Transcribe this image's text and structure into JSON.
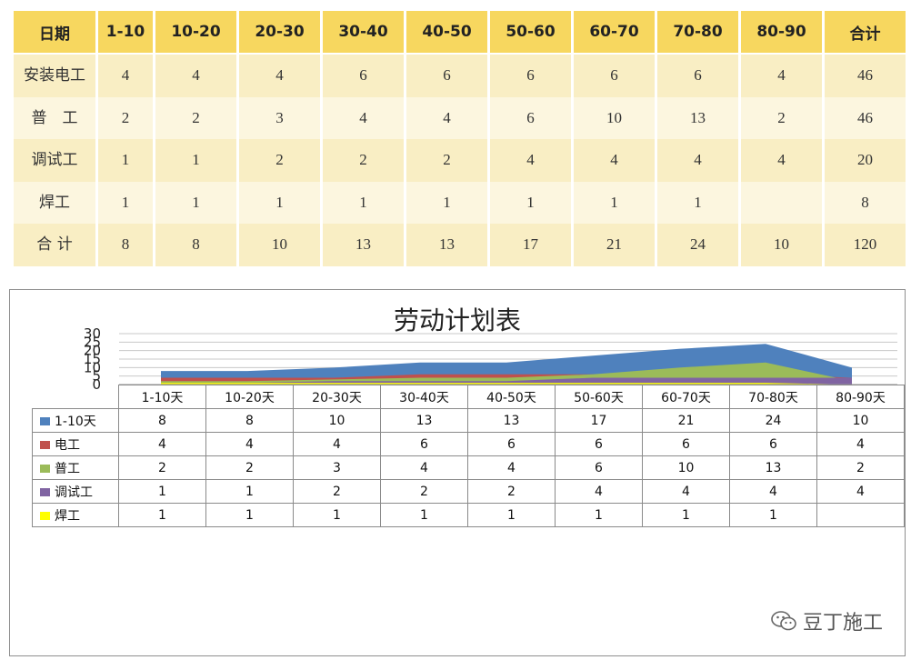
{
  "top_table": {
    "headers": [
      "日期",
      "1-10",
      "10-20",
      "20-30",
      "30-40",
      "40-50",
      "50-60",
      "60-70",
      "70-80",
      "80-90",
      "合计"
    ],
    "rows": [
      {
        "label": "安装电工",
        "values": [
          "4",
          "4",
          "4",
          "6",
          "6",
          "6",
          "6",
          "6",
          "4",
          "46"
        ]
      },
      {
        "label": "普　工",
        "values": [
          "2",
          "2",
          "3",
          "4",
          "4",
          "6",
          "10",
          "13",
          "2",
          "46"
        ]
      },
      {
        "label": "调试工",
        "values": [
          "1",
          "1",
          "2",
          "2",
          "2",
          "4",
          "4",
          "4",
          "4",
          "20"
        ]
      },
      {
        "label": "焊工",
        "values": [
          "1",
          "1",
          "1",
          "1",
          "1",
          "1",
          "1",
          "1",
          "",
          "8"
        ]
      },
      {
        "label": "合 计",
        "values": [
          "8",
          "8",
          "10",
          "13",
          "13",
          "17",
          "21",
          "24",
          "10",
          "120"
        ]
      }
    ]
  },
  "chart_data": {
    "type": "area",
    "title": "劳动计划表",
    "categories": [
      "1-10天",
      "10-20天",
      "20-30天",
      "30-40天",
      "40-50天",
      "50-60天",
      "60-70天",
      "70-80天",
      "80-90天"
    ],
    "ylim": [
      0,
      30
    ],
    "yticks": [
      "30",
      "25",
      "20",
      "15",
      "10",
      "5",
      "0"
    ],
    "grid": true,
    "legend": "data table below chart",
    "series": [
      {
        "name": "1-10天",
        "color": "#4f81bd",
        "values": [
          8,
          8,
          10,
          13,
          13,
          17,
          21,
          24,
          10
        ],
        "labels": [
          "8",
          "8",
          "10",
          "13",
          "13",
          "17",
          "21",
          "24",
          "10"
        ]
      },
      {
        "name": "电工",
        "color": "#c0504d",
        "values": [
          4,
          4,
          4,
          6,
          6,
          6,
          6,
          6,
          4
        ],
        "labels": [
          "4",
          "4",
          "4",
          "6",
          "6",
          "6",
          "6",
          "6",
          "4"
        ]
      },
      {
        "name": "普工",
        "color": "#9bbb59",
        "values": [
          2,
          2,
          3,
          4,
          4,
          6,
          10,
          13,
          2
        ],
        "labels": [
          "2",
          "2",
          "3",
          "4",
          "4",
          "6",
          "10",
          "13",
          "2"
        ]
      },
      {
        "name": "调试工",
        "color": "#8064a2",
        "values": [
          1,
          1,
          2,
          2,
          2,
          4,
          4,
          4,
          4
        ],
        "labels": [
          "1",
          "1",
          "2",
          "2",
          "2",
          "4",
          "4",
          "4",
          "4"
        ]
      },
      {
        "name": "焊工",
        "color": "#ffff00",
        "values": [
          1,
          1,
          1,
          1,
          1,
          1,
          1,
          1,
          0
        ],
        "labels": [
          "1",
          "1",
          "1",
          "1",
          "1",
          "1",
          "1",
          "1",
          ""
        ]
      }
    ]
  },
  "watermark": {
    "icon": "wechat-icon",
    "text": "豆丁施工"
  }
}
